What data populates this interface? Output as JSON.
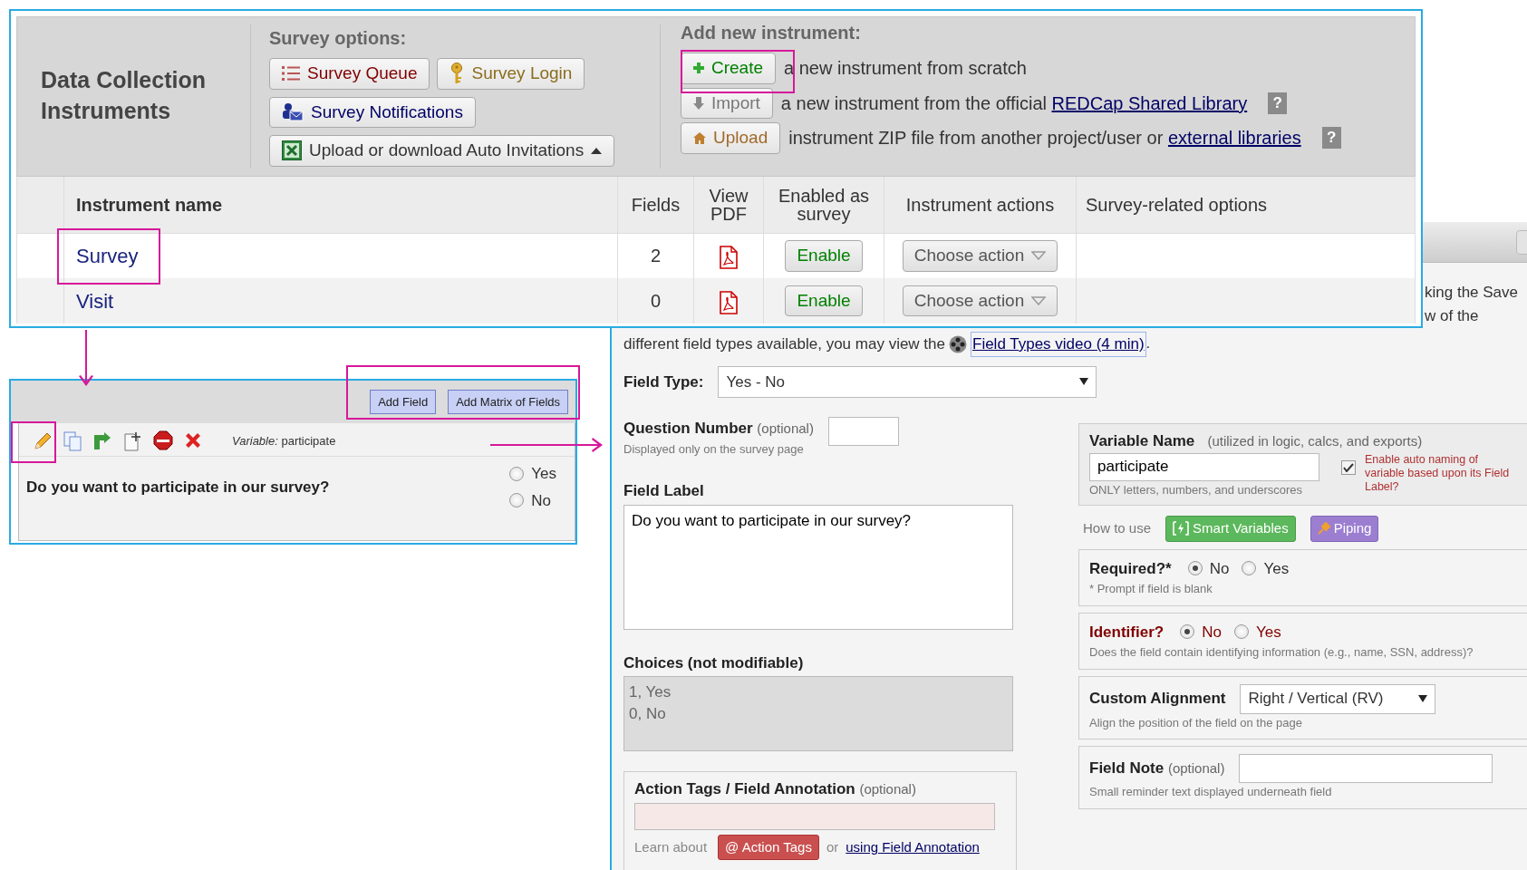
{
  "instruments": {
    "title": "Data Collection Instruments",
    "survey_options": {
      "label": "Survey options:",
      "buttons": [
        {
          "label": "Survey Queue",
          "kind": "queue"
        },
        {
          "label": "Survey Login",
          "kind": "login"
        },
        {
          "label": "Survey Notifications",
          "kind": "notifications"
        },
        {
          "label": "Upload or download Auto Invitations",
          "kind": "invitations"
        }
      ]
    },
    "add_new": {
      "label": "Add new instrument:",
      "options": [
        {
          "button": "Create",
          "kind": "create",
          "text": "a new instrument from scratch"
        },
        {
          "button": "Import",
          "kind": "import",
          "text": "a new instrument from the official",
          "link": "REDCap Shared Library",
          "help": "?"
        },
        {
          "button": "Upload",
          "kind": "upload",
          "text": "instrument ZIP file from another project/user or",
          "link": "external libraries",
          "help": "?"
        }
      ]
    },
    "table": {
      "columns": [
        "Instrument name",
        "Fields",
        "View PDF",
        "Enabled as survey",
        "Instrument actions",
        "Survey-related options"
      ],
      "rows": [
        {
          "name": "Survey",
          "fields": "2",
          "enable": "Enable",
          "action": "Choose action"
        },
        {
          "name": "Visit",
          "fields": "0",
          "enable": "Enable",
          "action": "Choose action"
        }
      ]
    }
  },
  "editor": {
    "buttons": [
      "Add Field",
      "Add Matrix of Fields"
    ],
    "variable_label": "Variable:",
    "variable": "participate",
    "question": "Do you want to participate in our survey?",
    "choices": [
      {
        "label": "Yes",
        "selected": false
      },
      {
        "label": "No",
        "selected": false
      }
    ]
  },
  "dialog": {
    "behind_text": [
      "king the Save",
      "w of the"
    ],
    "intro": "different field types available, you may view the",
    "video_link": "Field Types video (4 min)",
    "intro_end": ".",
    "field_type": {
      "label": "Field Type:",
      "value": "Yes - No"
    },
    "question_number": {
      "label": "Question Number",
      "note": "(optional)",
      "hint": "Displayed only on the survey page"
    },
    "field_label": {
      "label": "Field Label",
      "value": "Do you want to participate in our survey?"
    },
    "choices": {
      "label": "Choices (not modifiable)",
      "lines": [
        "1, Yes",
        "0, No"
      ]
    },
    "action_tags": {
      "label": "Action Tags / Field Annotation",
      "note": "(optional)",
      "learn": "Learn about",
      "tag_button": "@ Action Tags",
      "or": "or",
      "link": "using Field Annotation"
    },
    "variable_name": {
      "label": "Variable Name",
      "note": "(utilized in logic, calcs, and exports)",
      "value": "participate",
      "hint": "ONLY letters, numbers, and underscores",
      "auto_naming": {
        "checked": true,
        "label": "Enable auto naming of variable based upon its Field Label?"
      }
    },
    "how_to_use": {
      "label": "How to use",
      "buttons": [
        {
          "label": "Smart Variables",
          "kind": "smart"
        },
        {
          "label": "Piping",
          "kind": "piping"
        }
      ]
    },
    "required": {
      "label": "Required?*",
      "hint": "* Prompt if field is blank",
      "options": [
        {
          "label": "No",
          "selected": true
        },
        {
          "label": "Yes",
          "selected": false
        }
      ]
    },
    "identifier": {
      "label": "Identifier?",
      "hint": "Does the field contain identifying information (e.g., name, SSN, address)?",
      "options": [
        {
          "label": "No",
          "selected": true
        },
        {
          "label": "Yes",
          "selected": false
        }
      ]
    },
    "custom_alignment": {
      "label": "Custom Alignment",
      "value": "Right / Vertical (RV)",
      "hint": "Align the position of the field on the page"
    },
    "field_note": {
      "label": "Field Note",
      "note": "(optional)",
      "hint": "Small reminder text displayed underneath field"
    }
  }
}
